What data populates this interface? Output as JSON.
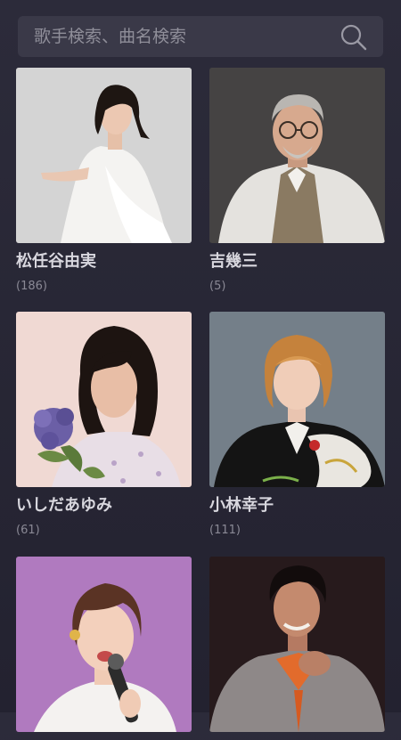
{
  "search": {
    "placeholder": "歌手検索、曲名検索",
    "icon": "search-icon"
  },
  "artists": [
    {
      "name": "松任谷由実",
      "count": "(186)",
      "photo": "artist-photo"
    },
    {
      "name": "吉幾三",
      "count": "(5)",
      "photo": "artist-photo"
    },
    {
      "name": "いしだあゆみ",
      "count": "(61)",
      "photo": "artist-photo"
    },
    {
      "name": "小林幸子",
      "count": "(111)",
      "photo": "artist-photo"
    },
    {
      "name": "",
      "count": "",
      "photo": "artist-photo"
    },
    {
      "name": "",
      "count": "",
      "photo": "artist-photo"
    }
  ]
}
